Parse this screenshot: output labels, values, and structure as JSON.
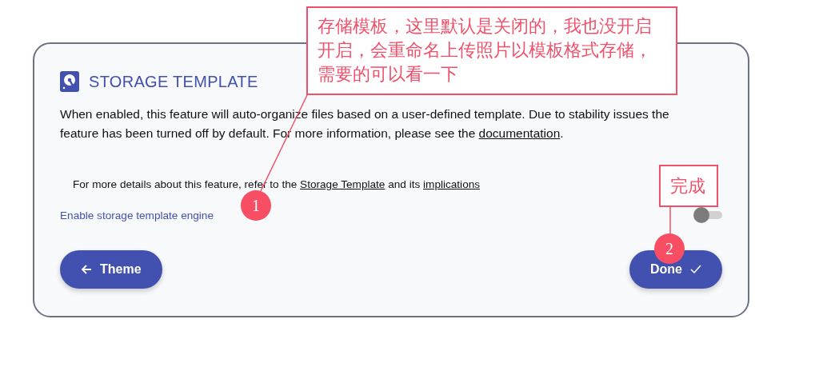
{
  "card": {
    "title": "STORAGE TEMPLATE",
    "description": [
      {
        "kind": "text",
        "text": "When enabled, this feature will auto-organize files based on a user-defined template. Due to stability issues the feature has been turned off by default. For more information, please see the "
      },
      {
        "kind": "link",
        "text": "documentation"
      },
      {
        "kind": "text",
        "text": "."
      }
    ],
    "details": [
      {
        "kind": "text",
        "text": "For more details about this feature, refer to the "
      },
      {
        "kind": "link",
        "text": "Storage Template"
      },
      {
        "kind": "text",
        "text": " and its "
      },
      {
        "kind": "link",
        "text": "implications"
      }
    ],
    "setting": {
      "label": "Enable storage template engine",
      "on": false
    },
    "buttons": [
      {
        "kind": "back",
        "label": "Theme"
      },
      {
        "kind": "done",
        "label": "Done"
      }
    ]
  },
  "annotations": [
    {
      "kind": "callout",
      "lines": [
        "存储模板，这里默认是关闭的，我也没开启",
        "开启，会重命名上传照片以模板格式存储，",
        "需要的可以看一下"
      ],
      "marker": "1"
    },
    {
      "kind": "tag",
      "lines": [
        "完成"
      ],
      "marker": "2"
    }
  ]
}
